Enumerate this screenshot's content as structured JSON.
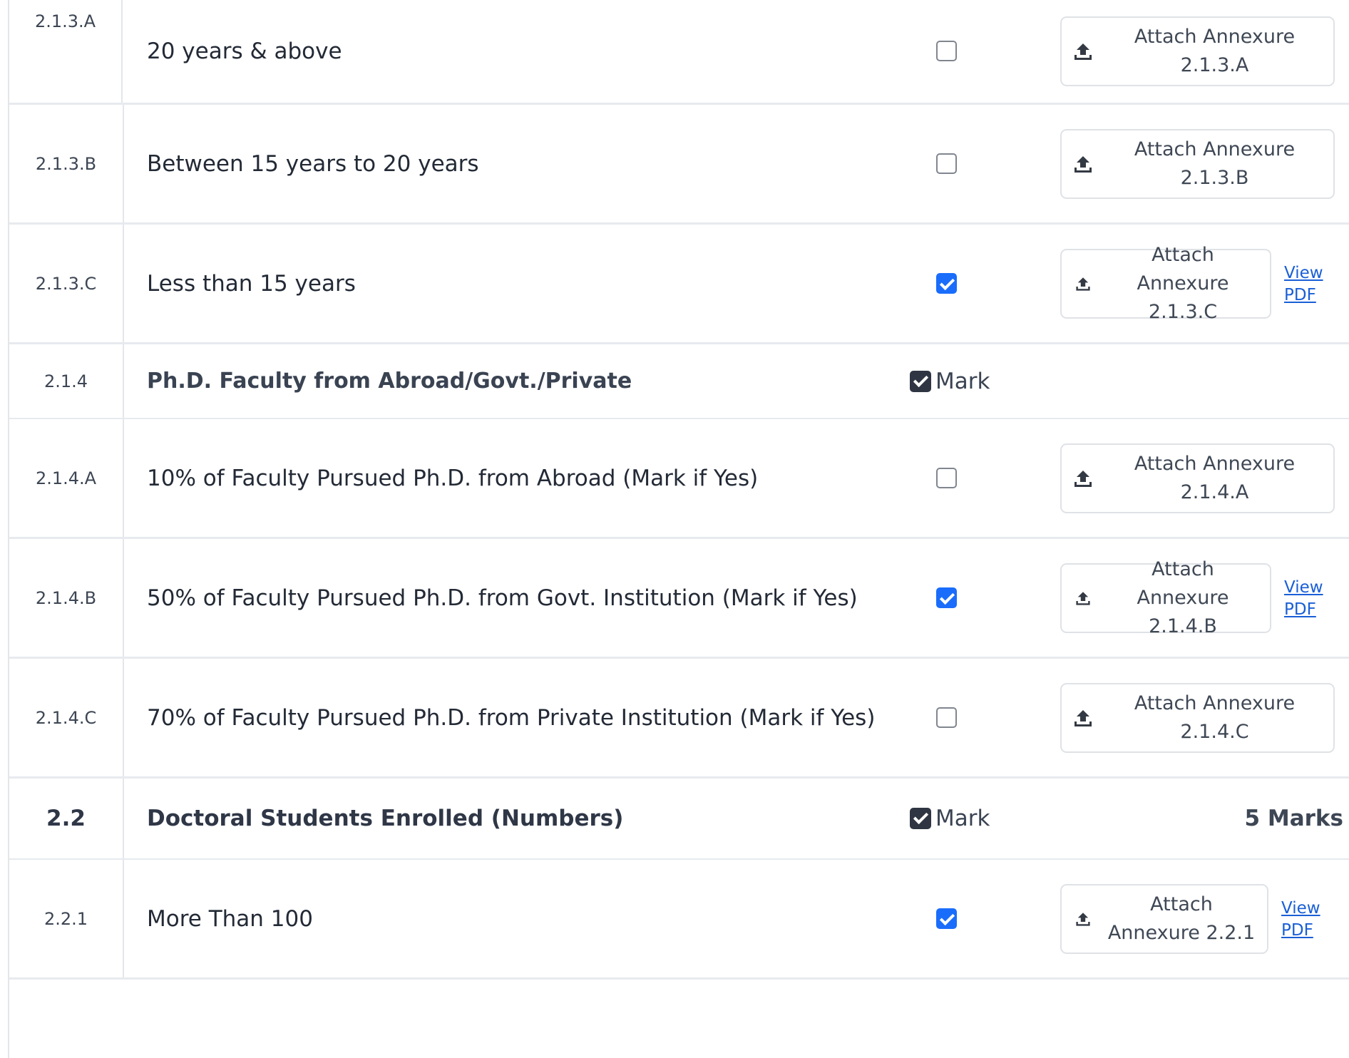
{
  "rows": [
    {
      "code": "2.1.3.A",
      "desc": "20 years & above",
      "checked": false,
      "attach": "Attach Annexure 2.1.3.A"
    },
    {
      "code": "2.1.3.B",
      "desc": "Between 15 years to 20 years",
      "checked": false,
      "attach": "Attach Annexure 2.1.3.B"
    },
    {
      "code": "2.1.3.C",
      "desc": "Less than 15 years",
      "checked": true,
      "attach": "Attach Annexure 2.1.3.C",
      "view": "View PDF"
    },
    {
      "code": "2.1.4",
      "desc": "Ph.D. Faculty from Abroad/Govt./Private",
      "mark": "Mark"
    },
    {
      "code": "2.1.4.A",
      "desc": "10% of Faculty Pursued Ph.D. from Abroad (Mark if Yes)",
      "checked": false,
      "attach": "Attach Annexure 2.1.4.A"
    },
    {
      "code": "2.1.4.B",
      "desc": "50% of Faculty Pursued Ph.D. from Govt. Institution (Mark if Yes)",
      "checked": true,
      "attach": "Attach Annexure 2.1.4.B",
      "view": "View PDF"
    },
    {
      "code": "2.1.4.C",
      "desc": "70% of Faculty Pursued Ph.D. from Private Institution (Mark if Yes)",
      "checked": false,
      "attach": "Attach Annexure 2.1.4.C"
    },
    {
      "code": "2.2",
      "desc": "Doctoral Students Enrolled (Numbers)",
      "mark": "Mark",
      "marks_total": "5 Marks"
    },
    {
      "code": "2.2.1",
      "desc": "More Than 100",
      "checked": true,
      "attach": "Attach Annexure 2.2.1",
      "view": "View PDF"
    }
  ]
}
